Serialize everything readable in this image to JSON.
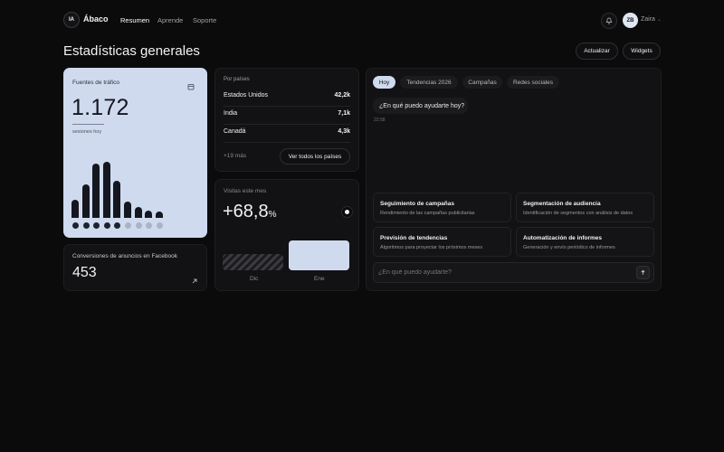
{
  "brand": {
    "logo_text": "IA",
    "name": "Ábaco"
  },
  "nav": [
    "Resumen",
    "Aprende",
    "Soporte"
  ],
  "user": {
    "initials": "ZB",
    "name": "Zaira"
  },
  "page": {
    "title": "Estadísticas generales",
    "actions": [
      "Actualizar",
      "Widgets"
    ]
  },
  "traffic": {
    "title": "Fuentes de tráfico",
    "value": "1.172",
    "subtitle": "sesiones hoy",
    "bars": [
      0.28,
      0.52,
      0.84,
      0.88,
      0.58,
      0.26,
      0.17,
      0.11,
      0.1
    ],
    "dots_active": 5,
    "dots_total": 9
  },
  "countries": {
    "title": "Por países",
    "rows": [
      {
        "name": "Estados Unidos",
        "value": "42,2k"
      },
      {
        "name": "India",
        "value": "7,1k"
      },
      {
        "name": "Canadá",
        "value": "4,3k"
      }
    ],
    "more": "+19 más",
    "cta": "Ver todos los países"
  },
  "ads": {
    "title": "Conversiones de anuncios en Facebook",
    "value": "453"
  },
  "visits": {
    "title": "Visitas este mes",
    "value": "+68,8",
    "unit": "%",
    "bars": [
      {
        "label": "Dic",
        "relative": 0.55
      },
      {
        "label": "Ene",
        "relative": 1.0
      }
    ]
  },
  "assistant": {
    "tabs": [
      "Hoy",
      "Tendencias 2026",
      "Campañas",
      "Redes sociales"
    ],
    "active_tab": 0,
    "message": "¿En qué puedo ayudarte hoy?",
    "time": "22:58",
    "features": [
      {
        "title": "Seguimiento de campañas",
        "desc": "Rendimiento de las campañas publicitarias"
      },
      {
        "title": "Segmentación de audiencia",
        "desc": "Identificación de segmentos con análisis de datos"
      },
      {
        "title": "Previsión de tendencias",
        "desc": "Algoritmos para proyectar los próximos meses"
      },
      {
        "title": "Automatización de informes",
        "desc": "Generación y envío periódico de informes"
      }
    ],
    "input_placeholder": "¿En qué puedo ayudarte?"
  },
  "colors": {
    "background": "#0b0b0c",
    "card": "#121214",
    "accent_light": "#cfdaee",
    "bar_dark": "#14171f"
  },
  "icons": [
    "bell-icon",
    "chevron-down-icon",
    "calendar-icon",
    "arrow-up-right-icon",
    "send-arrow-icon"
  ]
}
